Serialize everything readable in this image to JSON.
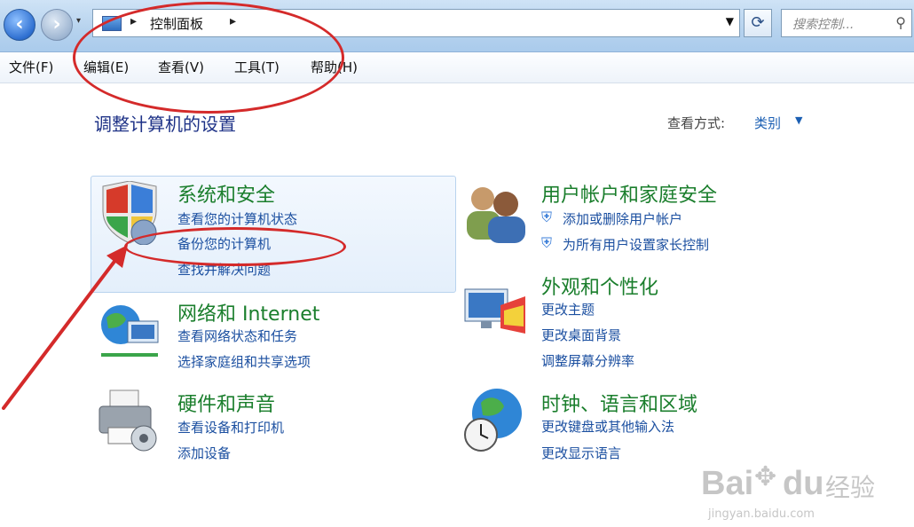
{
  "address": {
    "breadcrumb": "控制面板"
  },
  "search": {
    "placeholder": "搜索控制..."
  },
  "menu": [
    "文件(F)",
    "编辑(E)",
    "查看(V)",
    "工具(T)",
    "帮助(H)"
  ],
  "page": {
    "title": "调整计算机的设置",
    "view_by_label": "查看方式:",
    "view_by_value": "类别"
  },
  "categories": {
    "system_security": {
      "title": "系统和安全",
      "links": [
        "查看您的计算机状态",
        "备份您的计算机",
        "查找并解决问题"
      ]
    },
    "user_accounts": {
      "title": "用户帐户和家庭安全",
      "links": [
        "添加或删除用户帐户",
        "为所有用户设置家长控制"
      ]
    },
    "network": {
      "title": "网络和 Internet",
      "links": [
        "查看网络状态和任务",
        "选择家庭组和共享选项"
      ]
    },
    "appearance": {
      "title": "外观和个性化",
      "links": [
        "更改主题",
        "更改桌面背景",
        "调整屏幕分辨率"
      ]
    },
    "hardware": {
      "title": "硬件和声音",
      "links": [
        "查看设备和打印机",
        "添加设备"
      ]
    },
    "clock": {
      "title": "时钟、语言和区域",
      "links": [
        "更改键盘或其他输入法",
        "更改显示语言"
      ]
    }
  },
  "watermark": {
    "brand": "Bai",
    "brand2": "du",
    "label": "经验",
    "url": "jingyan.baidu.com"
  },
  "colors": {
    "category_title": "#1a7e2c",
    "link": "#1b4fa0",
    "annotation": "#d42a2a",
    "title_bar": "#b7d3ee"
  }
}
